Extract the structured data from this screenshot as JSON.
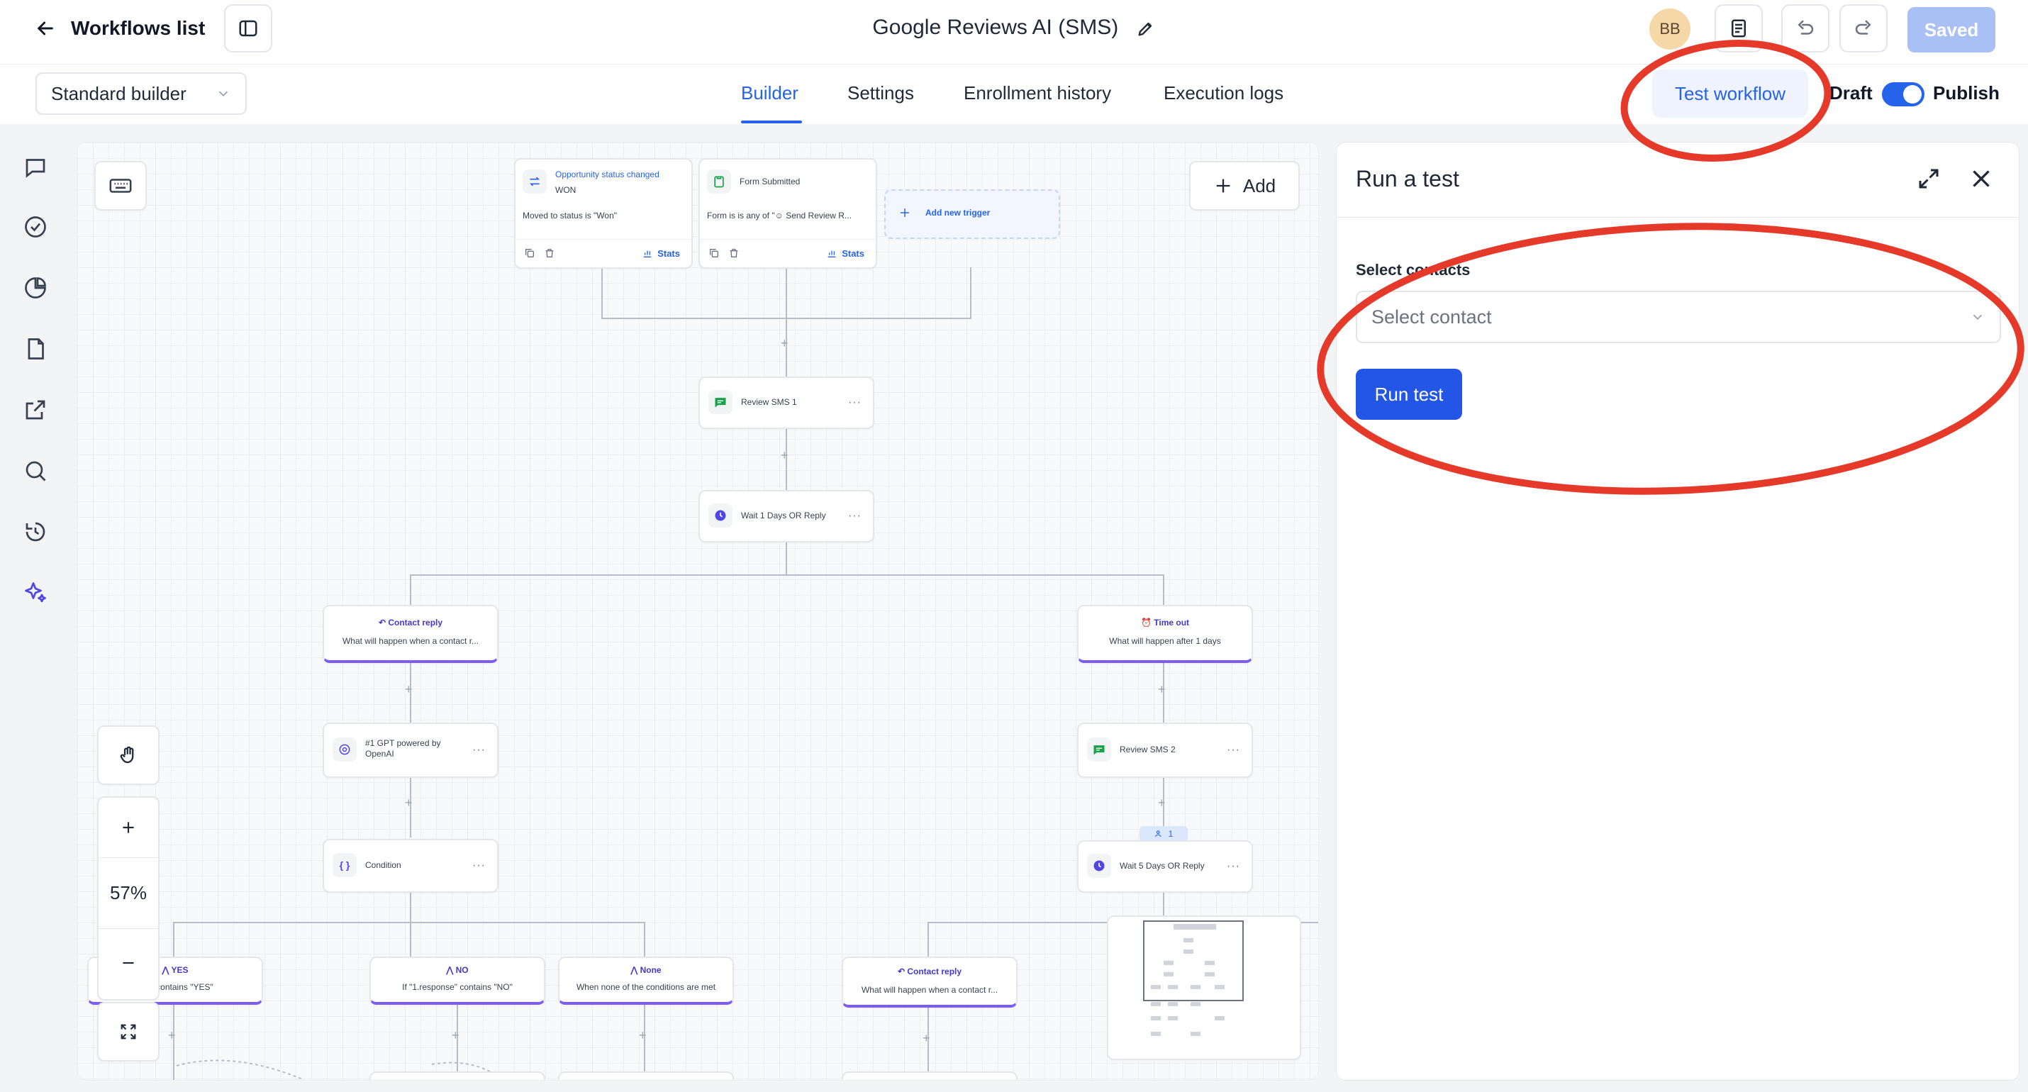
{
  "header": {
    "back_label": "Workflows list",
    "title": "Google Reviews AI (SMS)",
    "avatar_initials": "BB",
    "saved_label": "Saved"
  },
  "subheader": {
    "builder_select": "Standard builder",
    "tabs": [
      {
        "label": "Builder",
        "active": true
      },
      {
        "label": "Settings",
        "active": false
      },
      {
        "label": "Enrollment history",
        "active": false
      },
      {
        "label": "Execution logs",
        "active": false
      }
    ],
    "test_workflow_label": "Test workflow",
    "draft_label": "Draft",
    "publish_label": "Publish",
    "publish_toggle_on": true
  },
  "canvas": {
    "add_label": "Add",
    "zoom": "57%",
    "triggers": [
      {
        "title": "Opportunity status changed",
        "subtitle": "WON",
        "detail": "Moved to status is \"Won\"",
        "stats": "Stats"
      },
      {
        "title": "Form Submitted",
        "detail": "Form is is any of \"☺ Send Review R...",
        "stats": "Stats"
      }
    ],
    "add_trigger_label": "Add new trigger",
    "nodes": {
      "review_sms_1": "Review SMS 1",
      "wait_1": "Wait 1 Days OR Reply",
      "gpt": "#1 GPT powered by OpenAI",
      "condition": "Condition",
      "review_sms_2": "Review SMS 2",
      "wait_5": "Wait 5 Days OR Reply",
      "contact_count": "1"
    },
    "branches": {
      "contact_reply_title": "Contact reply",
      "contact_reply_sub": "What will happen when a contact r...",
      "timeout_title": "Time out",
      "timeout_sub": "What will happen after 1 days",
      "yes_title": "YES",
      "yes_sub": "nse\" contains \"YES\"",
      "no_title": "NO",
      "no_sub": "If \"1.response\" contains \"NO\"",
      "none_title": "None",
      "none_sub": "When none of the conditions are met",
      "contact_reply2_title": "Contact reply",
      "contact_reply2_sub": "What will happen when a contact r..."
    }
  },
  "panel": {
    "title": "Run a test",
    "field_label": "Select contacts",
    "select_placeholder": "Select contact",
    "run_button": "Run test"
  },
  "colors": {
    "accent": "#2563eb",
    "annotation_red": "#e53a2a",
    "branch_purple": "#7c5cf5"
  }
}
